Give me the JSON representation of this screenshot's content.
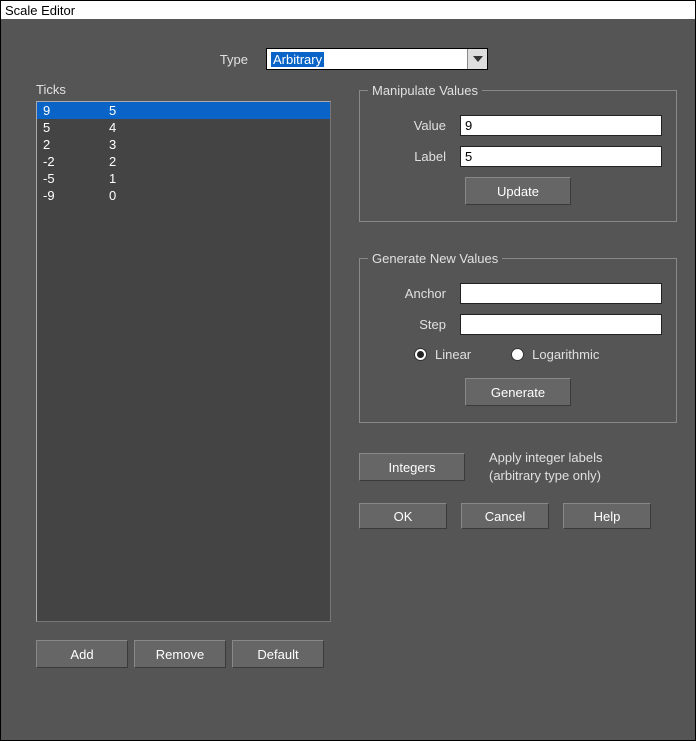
{
  "window": {
    "title": "Scale Editor"
  },
  "type": {
    "label": "Type",
    "value": "Arbitrary"
  },
  "ticks": {
    "label": "Ticks",
    "rows": [
      {
        "value": "9",
        "label": "5",
        "selected": true
      },
      {
        "value": "5",
        "label": "4",
        "selected": false
      },
      {
        "value": "2",
        "label": "3",
        "selected": false
      },
      {
        "value": "-2",
        "label": "2",
        "selected": false
      },
      {
        "value": "-5",
        "label": "1",
        "selected": false
      },
      {
        "value": "-9",
        "label": "0",
        "selected": false
      }
    ],
    "buttons": {
      "add": "Add",
      "remove": "Remove",
      "default": "Default"
    }
  },
  "manipulate": {
    "title": "Manipulate Values",
    "value_label": "Value",
    "value_input": "9",
    "label_label": "Label",
    "label_input": "5",
    "update": "Update"
  },
  "generate": {
    "title": "Generate New Values",
    "anchor_label": "Anchor",
    "anchor_input": "",
    "step_label": "Step",
    "step_input": "",
    "linear": "Linear",
    "logarithmic": "Logarithmic",
    "selected": "linear",
    "generate": "Generate"
  },
  "integers": {
    "button": "Integers",
    "line1": "Apply integer labels",
    "line2": "(arbitrary type only)"
  },
  "footer": {
    "ok": "OK",
    "cancel": "Cancel",
    "help": "Help"
  }
}
